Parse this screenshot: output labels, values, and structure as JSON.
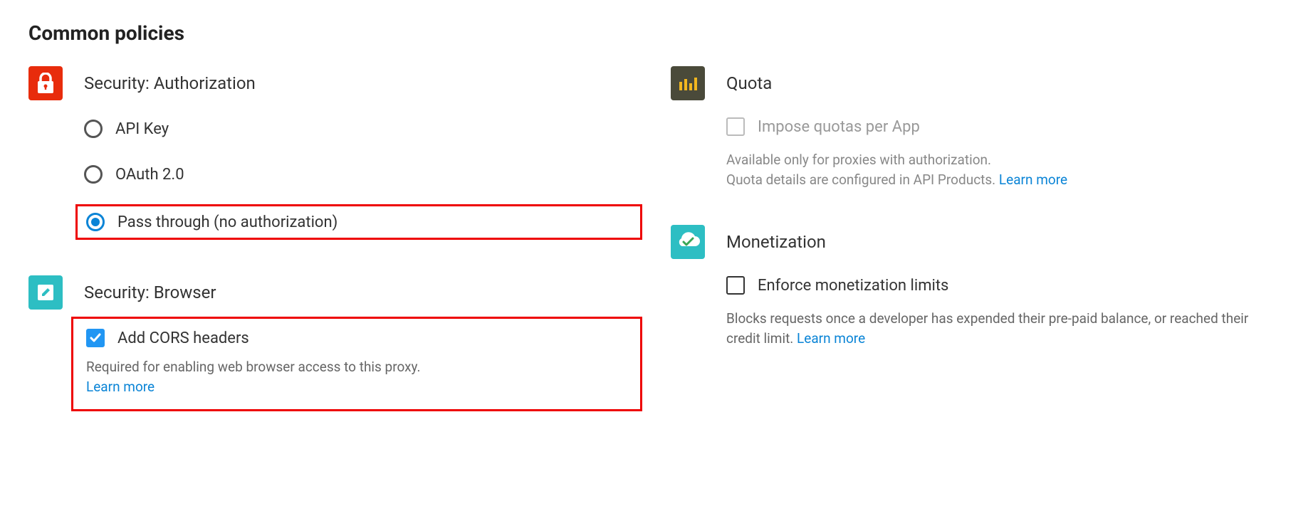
{
  "page": {
    "title": "Common policies"
  },
  "security_auth": {
    "title": "Security: Authorization",
    "options": {
      "api_key": "API Key",
      "oauth": "OAuth 2.0",
      "passthrough": "Pass through (no authorization)"
    },
    "selected": "passthrough"
  },
  "security_browser": {
    "title": "Security: Browser",
    "cors_label": "Add CORS headers",
    "cors_checked": true,
    "help": "Required for enabling web browser access to this proxy.",
    "learn_more": "Learn more"
  },
  "quota": {
    "title": "Quota",
    "checkbox_label": "Impose quotas per App",
    "checkbox_enabled": false,
    "help_line1": "Available only for proxies with authorization.",
    "help_line2": "Quota details are configured in API Products.",
    "learn_more": "Learn more"
  },
  "monetization": {
    "title": "Monetization",
    "checkbox_label": "Enforce monetization limits",
    "help": "Blocks requests once a developer has expended their pre-paid balance, or reached their credit limit.",
    "learn_more": "Learn more"
  }
}
